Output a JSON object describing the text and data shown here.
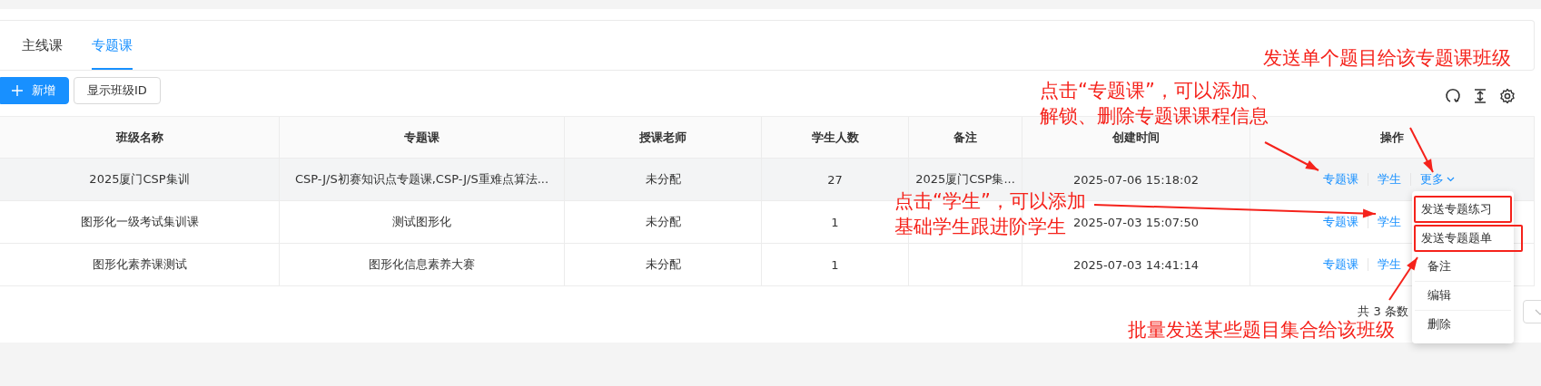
{
  "tabs": [
    {
      "label": "主线课",
      "selected": false
    },
    {
      "label": "专题课",
      "selected": true
    }
  ],
  "toolbar": {
    "add_button": "新增",
    "show_id_button": "显示班级ID"
  },
  "table": {
    "columns": [
      "班级名称",
      "专题课",
      "授课老师",
      "学生人数",
      "备注",
      "创建时间",
      "操作"
    ],
    "rows": [
      {
        "hovered": true,
        "cells": [
          "2025厦门CSP集训",
          "CSP-J/S初赛知识点专题课,CSP-J/S重难点算法...",
          "未分配",
          "27",
          "2025厦门CSP集...",
          "2025-07-06 15:18:02"
        ],
        "actions": [
          {
            "kind": "link",
            "label": "专题课"
          },
          {
            "kind": "link",
            "label": "学生"
          },
          {
            "kind": "more",
            "label": "更多"
          }
        ]
      },
      {
        "hovered": false,
        "cells": [
          "图形化一级考试集训课",
          "测试图形化",
          "未分配",
          "1",
          "",
          "2025-07-03 15:07:50"
        ],
        "actions": [
          {
            "kind": "link",
            "label": "专题课"
          },
          {
            "kind": "link",
            "label": "学生"
          }
        ]
      },
      {
        "hovered": false,
        "cells": [
          "图形化素养课测试",
          "图形化信息素养大赛",
          "未分配",
          "1",
          "",
          "2025-07-03 14:41:14"
        ],
        "actions": [
          {
            "kind": "link",
            "label": "专题课"
          },
          {
            "kind": "link",
            "label": "学生"
          }
        ]
      }
    ]
  },
  "pagination": {
    "total": "共 3 条数"
  },
  "dropdown_menu": {
    "items": [
      {
        "label": "发送专题练习",
        "highlighted": true
      },
      {
        "label": "发送专题题单",
        "highlighted": true
      },
      {
        "label": "备注",
        "highlighted": false
      },
      {
        "label": "编辑",
        "highlighted": false
      },
      {
        "label": "删除",
        "highlighted": false
      }
    ]
  },
  "annotations": [
    {
      "lines": [
        "发送单个题目给该专题课班级"
      ]
    },
    {
      "lines": [
        "点击“专题课”，可以添加、",
        "解锁、删除专题课课程信息"
      ]
    },
    {
      "lines": [
        "点击“学生”，可以添加",
        "基础学生跟进阶学生"
      ]
    },
    {
      "lines": [
        "批量发送某些题目集合给该班级"
      ]
    }
  ]
}
